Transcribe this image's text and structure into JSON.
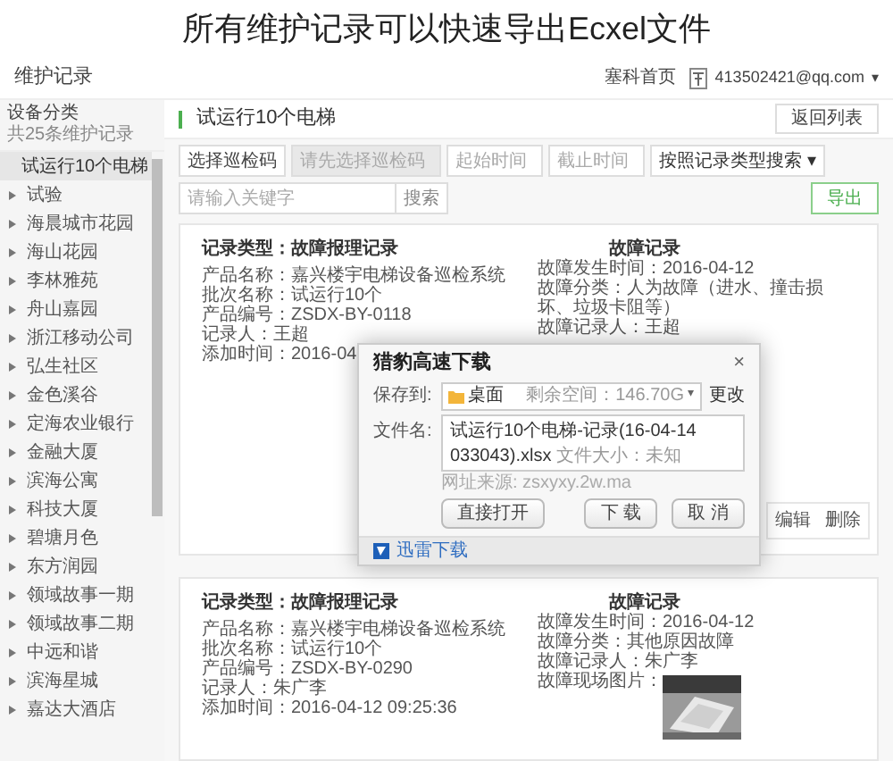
{
  "caption": "所有维护记录可以快速导出Ecxel文件",
  "header": {
    "title": "维护记录",
    "home_link": "塞科首页",
    "user": "413502421@qq.com",
    "user_caret": "▾"
  },
  "sidebar": {
    "title": "设备分类",
    "count": "共25条维护记录",
    "items": [
      {
        "label": "试运行10个电梯",
        "selected": true
      },
      {
        "label": "试验",
        "selected": false
      },
      {
        "label": "海晨城市花园",
        "selected": false
      },
      {
        "label": "海山花园",
        "selected": false
      },
      {
        "label": "李林雅苑",
        "selected": false
      },
      {
        "label": "舟山嘉园",
        "selected": false
      },
      {
        "label": "浙江移动公司",
        "selected": false
      },
      {
        "label": "弘生社区",
        "selected": false
      },
      {
        "label": "金色溪谷",
        "selected": false
      },
      {
        "label": "定海农业银行",
        "selected": false
      },
      {
        "label": "金融大厦",
        "selected": false
      },
      {
        "label": "滨海公寓",
        "selected": false
      },
      {
        "label": "科技大厦",
        "selected": false
      },
      {
        "label": "碧塘月色",
        "selected": false
      },
      {
        "label": "东方润园",
        "selected": false
      },
      {
        "label": "领域故事一期",
        "selected": false
      },
      {
        "label": "领域故事二期",
        "selected": false
      },
      {
        "label": "中远和谐",
        "selected": false
      },
      {
        "label": "滨海星城",
        "selected": false
      },
      {
        "label": "嘉达大酒店",
        "selected": false
      }
    ]
  },
  "main": {
    "title": "试运行10个电梯",
    "back_button": "返回列表",
    "toolbar": {
      "code_button": "选择巡检码",
      "code_field": {
        "placeholder": "请先选择巡检码",
        "disabled": true
      },
      "start_field": {
        "placeholder": "起始时间"
      },
      "end_field": {
        "placeholder": "截止时间"
      },
      "type_select": "按照记录类型搜索",
      "type_caret": "▾",
      "keyword_field": {
        "placeholder": "请输入关键字"
      },
      "search_button": "搜索",
      "export_button": "导出"
    },
    "records": [
      {
        "type_line": "记录类型：故障报理记录",
        "details": [
          {
            "label": "产品名称：",
            "value": "嘉兴楼宇电梯设备巡检系统"
          },
          {
            "label": "批次名称：",
            "value": "试运行10个"
          },
          {
            "label": "产品编号：",
            "value": "ZSDX-BY-0118"
          },
          {
            "label": "记录人：",
            "value": "王超"
          },
          {
            "label": "添加时间：",
            "value": "2016-04"
          }
        ],
        "fault_title": "故障记录",
        "fault": [
          {
            "label": "故障发生时间：",
            "value": "2016-04-12",
            "kind": "text"
          },
          {
            "label": "故障分类：",
            "value": "人为故障（进水、撞击损坏、垃圾卡阻等）",
            "kind": "text"
          },
          {
            "label": "故障记录人：",
            "value": "王超",
            "kind": "text"
          }
        ],
        "actions": [
          "编辑",
          "删除"
        ]
      },
      {
        "type_line": "记录类型：故障报理记录",
        "details": [
          {
            "label": "产品名称：",
            "value": "嘉兴楼宇电梯设备巡检系统"
          },
          {
            "label": "批次名称：",
            "value": "试运行10个"
          },
          {
            "label": "产品编号：",
            "value": "ZSDX-BY-0290"
          },
          {
            "label": "记录人：",
            "value": "朱广李"
          },
          {
            "label": "添加时间：",
            "value": "2016-04-12 09:25:36"
          }
        ],
        "fault_title": "故障记录",
        "fault": [
          {
            "label": "故障发生时间：",
            "value": "2016-04-12",
            "kind": "text"
          },
          {
            "label": "故障分类：",
            "value": "其他原因故障",
            "kind": "text"
          },
          {
            "label": "故障记录人：",
            "value": "朱广李",
            "kind": "text"
          },
          {
            "label": "故障现场图片：",
            "kind": "picture"
          }
        ]
      }
    ]
  },
  "dialog": {
    "title": "猎豹高速下载",
    "close": "×",
    "save_label": "保存到:",
    "save_folder": "桌面",
    "free_space": "剩余空间：146.70G",
    "save_caret": "▾",
    "change_link": "更改",
    "file_label": "文件名:",
    "file_name": "试运行10个电梯-记录(16-04-14 033043).xlsx",
    "file_size": "文件大小：未知",
    "source": "网址来源: zsxyxy.2w.ma",
    "buttons": [
      "直接打开",
      "下 载",
      "取 消"
    ],
    "footer_link": "迅雷下载"
  }
}
